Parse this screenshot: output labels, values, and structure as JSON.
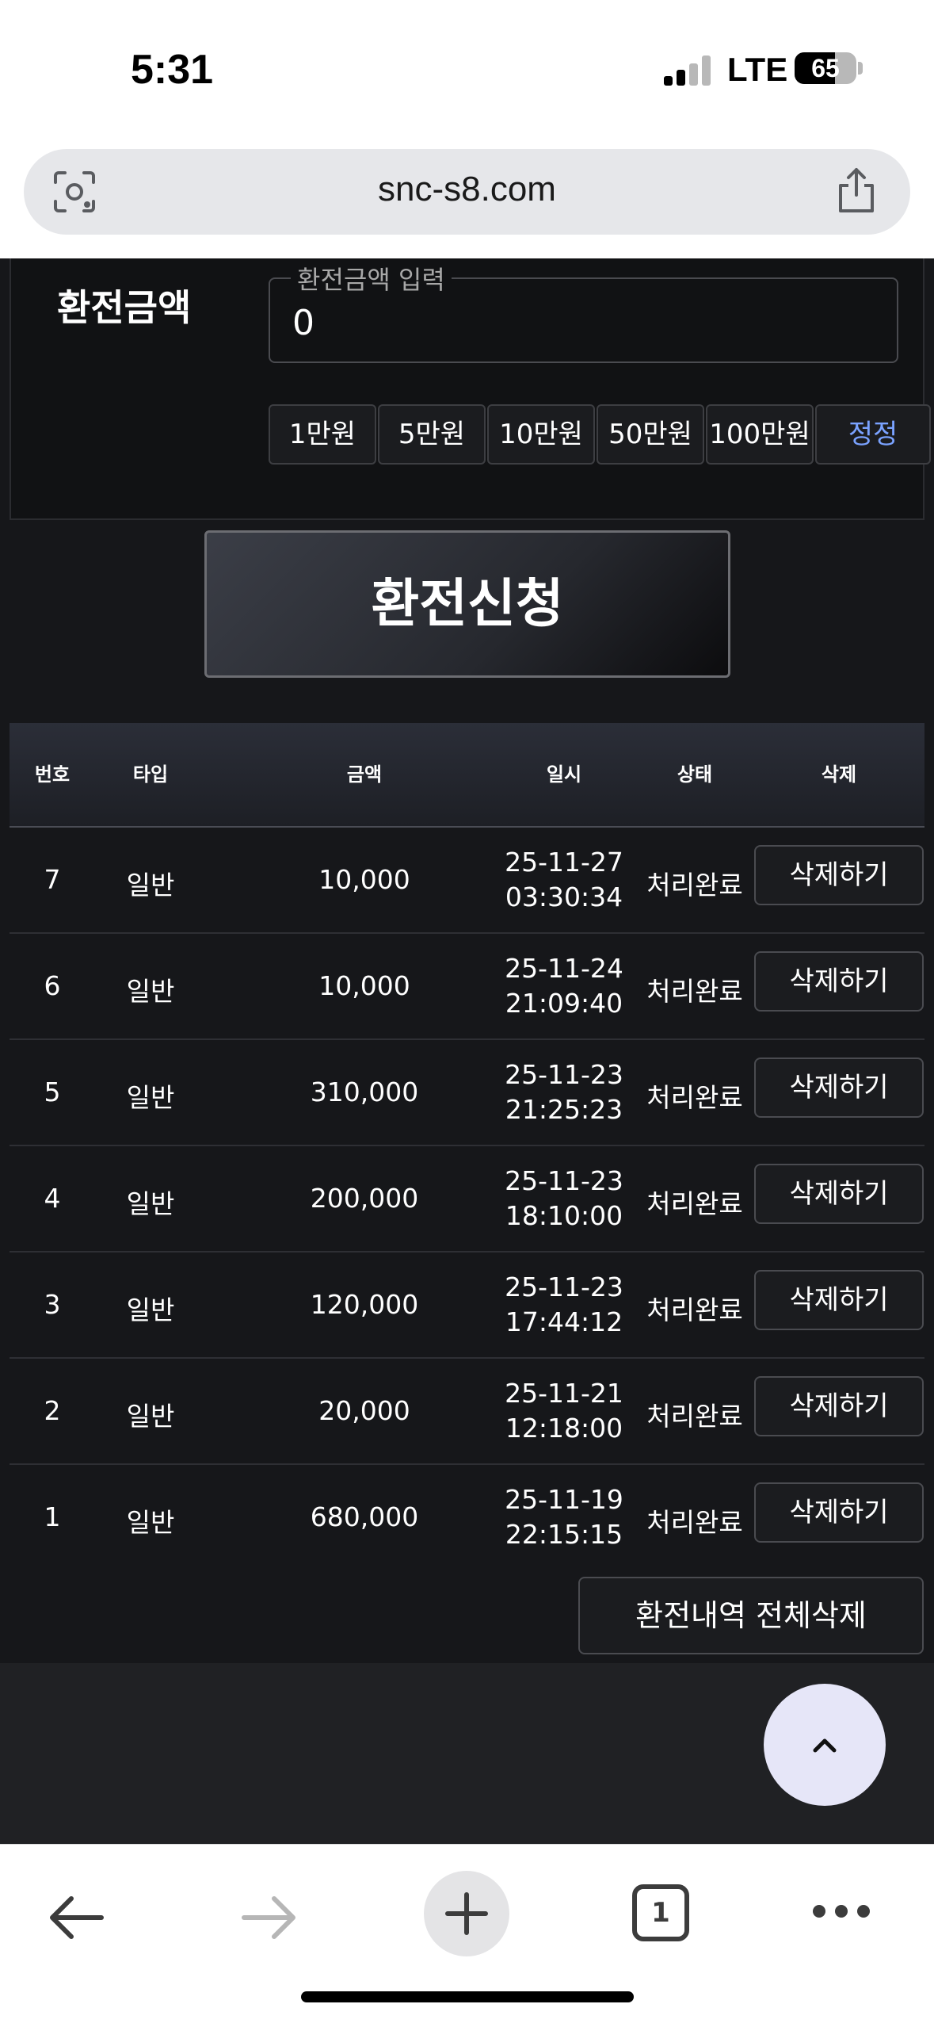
{
  "status_bar": {
    "time": "5:31",
    "network": "LTE",
    "battery": "65",
    "battery_level_percent": 65
  },
  "browser": {
    "url": "snc-s8.com"
  },
  "form": {
    "amount_label": "환전금액",
    "amount_legend": "환전금액 입력",
    "amount_value": "0",
    "quick_amounts": [
      "1만원",
      "5만원",
      "10만원",
      "50만원",
      "100만원"
    ],
    "reset_label": "정정",
    "submit_label": "환전신청"
  },
  "table": {
    "headers": {
      "no": "번호",
      "type": "타입",
      "amount": "금액",
      "date": "일시",
      "status": "상태",
      "delete": "삭제"
    },
    "rows": [
      {
        "no": "7",
        "type": "일반",
        "amount": "10,000",
        "date": "25-11-27",
        "time": "03:30:34",
        "status": "처리완료",
        "delete": "삭제하기"
      },
      {
        "no": "6",
        "type": "일반",
        "amount": "10,000",
        "date": "25-11-24",
        "time": "21:09:40",
        "status": "처리완료",
        "delete": "삭제하기"
      },
      {
        "no": "5",
        "type": "일반",
        "amount": "310,000",
        "date": "25-11-23",
        "time": "21:25:23",
        "status": "처리완료",
        "delete": "삭제하기"
      },
      {
        "no": "4",
        "type": "일반",
        "amount": "200,000",
        "date": "25-11-23",
        "time": "18:10:00",
        "status": "처리완료",
        "delete": "삭제하기"
      },
      {
        "no": "3",
        "type": "일반",
        "amount": "120,000",
        "date": "25-11-23",
        "time": "17:44:12",
        "status": "처리완료",
        "delete": "삭제하기"
      },
      {
        "no": "2",
        "type": "일반",
        "amount": "20,000",
        "date": "25-11-21",
        "time": "12:18:00",
        "status": "처리완료",
        "delete": "삭제하기"
      },
      {
        "no": "1",
        "type": "일반",
        "amount": "680,000",
        "date": "25-11-19",
        "time": "22:15:15",
        "status": "처리완료",
        "delete": "삭제하기"
      }
    ],
    "delete_all_label": "환전내역 전체삭제"
  },
  "toolbar": {
    "tab_count": "1"
  }
}
